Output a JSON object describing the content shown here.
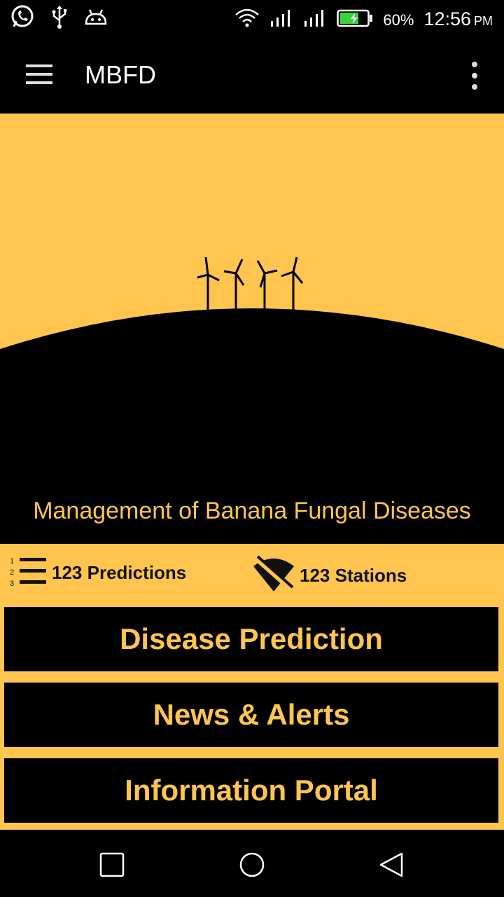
{
  "status_bar": {
    "battery_percent": "60%",
    "time": "12:56",
    "ampm": "PM",
    "icons": [
      "whatsapp-icon",
      "usb-icon",
      "android-debug-icon",
      "wifi-icon",
      "signal-icon",
      "signal-icon",
      "battery-charging-icon"
    ]
  },
  "app_bar": {
    "title": "MBFD",
    "menu_icon": "hamburger-icon",
    "overflow_icon": "more-vert-icon"
  },
  "hero": {
    "subtitle": "Management of Banana Fungal Diseases",
    "illustration": "wind-turbines-on-hill"
  },
  "stats": {
    "predictions_label": "123 Predictions",
    "predictions_icon": "numbered-list-icon",
    "stations_label": "123 Stations",
    "stations_icon": "wifi-off-icon"
  },
  "buttons": {
    "disease_prediction": "Disease Prediction",
    "news_alerts": "News & Alerts",
    "information_portal": "Information Portal"
  },
  "nav_bar": {
    "icons": [
      "recent-apps-icon",
      "home-icon",
      "back-icon"
    ]
  },
  "colors": {
    "accent": "#FFC54E",
    "background": "#000000"
  }
}
